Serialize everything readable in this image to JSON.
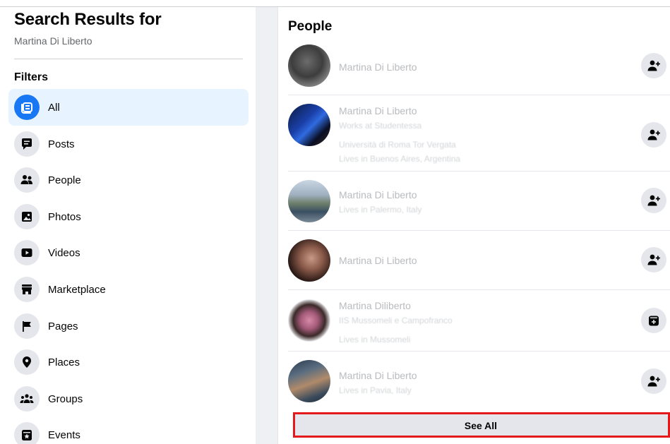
{
  "sidebar": {
    "title": "Search Results for",
    "query": "Martina Di Liberto",
    "filters_label": "Filters",
    "items": [
      {
        "label": "All",
        "icon": "feed-icon",
        "active": true
      },
      {
        "label": "Posts",
        "icon": "chat-bubble-icon"
      },
      {
        "label": "People",
        "icon": "people-icon"
      },
      {
        "label": "Photos",
        "icon": "photo-icon"
      },
      {
        "label": "Videos",
        "icon": "play-icon"
      },
      {
        "label": "Marketplace",
        "icon": "shop-icon"
      },
      {
        "label": "Pages",
        "icon": "flag-icon"
      },
      {
        "label": "Places",
        "icon": "pin-icon"
      },
      {
        "label": "Groups",
        "icon": "groups-icon"
      },
      {
        "label": "Events",
        "icon": "calendar-star-icon"
      }
    ]
  },
  "main": {
    "section_title": "People",
    "people": [
      {
        "name": "Martina Di Liberto",
        "lines": [],
        "action_icon": "add-friend-icon"
      },
      {
        "name": "Martina Di Liberto",
        "lines": [
          "Works at Studentessa",
          "Università di Roma Tor Vergata",
          "Lives in Buenos Aires, Argentina"
        ],
        "action_icon": "add-friend-icon"
      },
      {
        "name": "Martina Di Liberto",
        "lines": [
          "Lives in Palermo, Italy"
        ],
        "action_icon": "add-friend-icon"
      },
      {
        "name": "Martina Di Liberto",
        "lines": [],
        "action_icon": "add-friend-icon"
      },
      {
        "name": "Martina Diliberto",
        "lines": [
          "IIS Mussomeli e Campofranco",
          "Lives in Mussomeli"
        ],
        "action_icon": "message-icon"
      },
      {
        "name": "Martina Di Liberto",
        "lines": [
          "Lives in Pavia, Italy"
        ],
        "action_icon": "add-friend-icon"
      }
    ],
    "see_all_label": "See All"
  },
  "colors": {
    "accent": "#1877f2",
    "active_bg": "#e7f3ff",
    "highlight": "#e3191c"
  }
}
